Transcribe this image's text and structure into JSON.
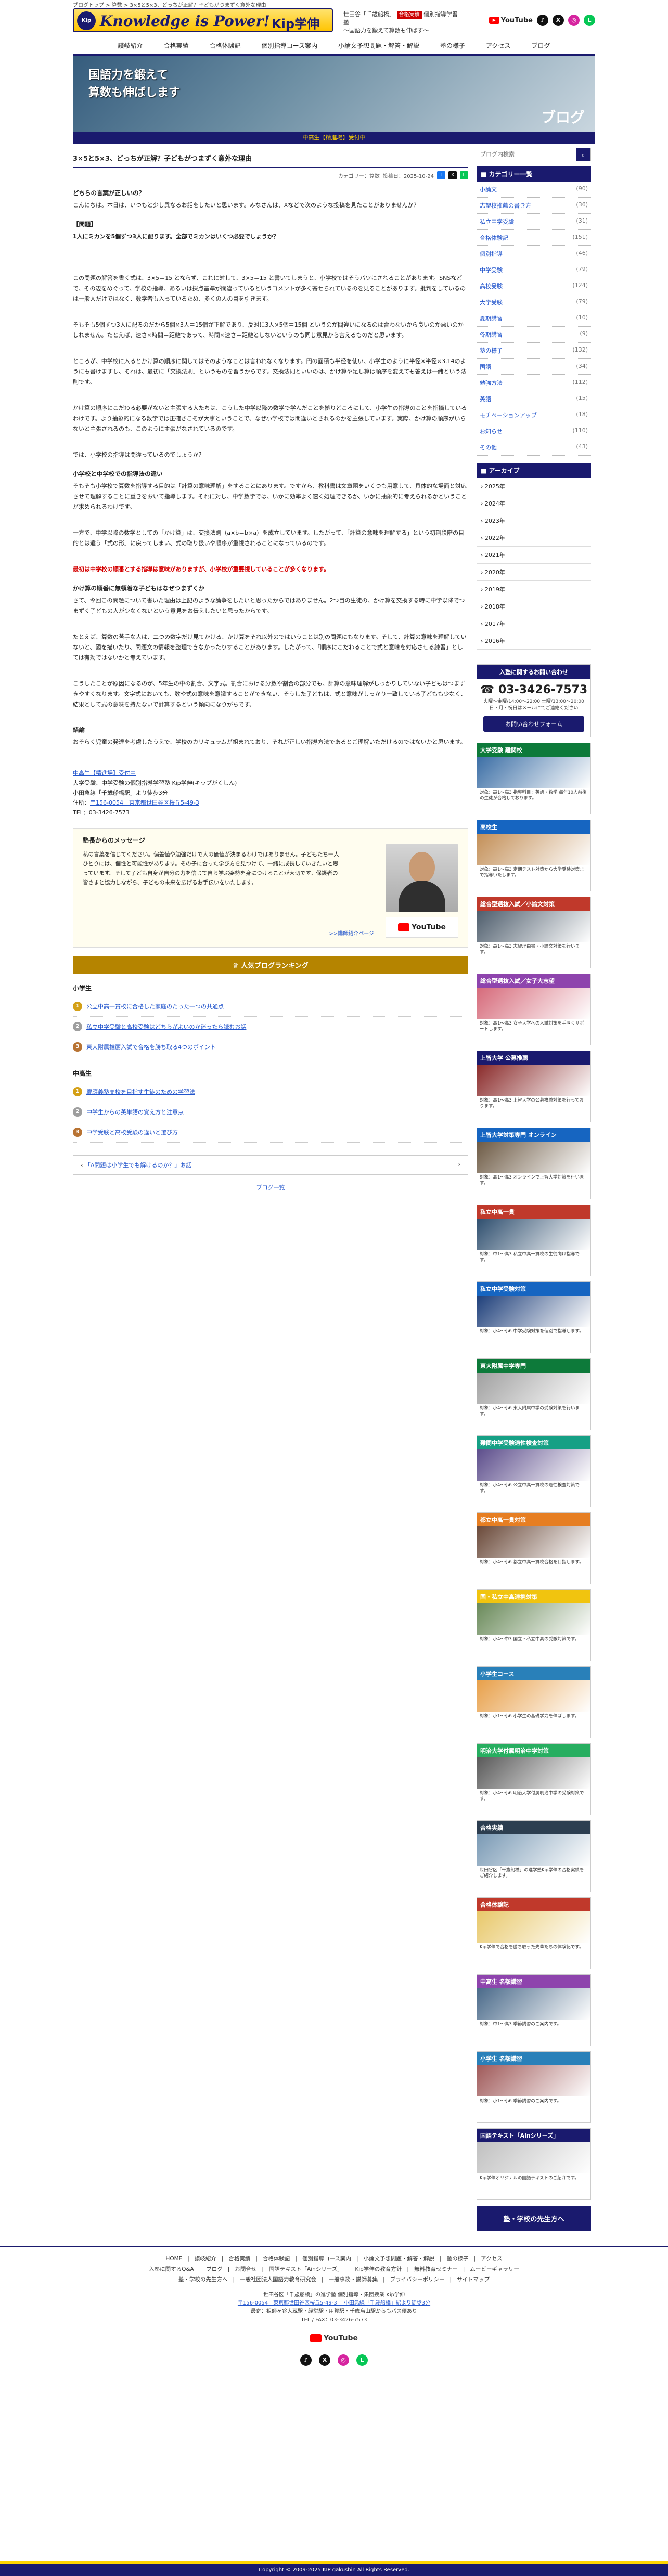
{
  "topline": "ブログトップ > 算数 > 3×5と5×3、どっちが正解？子どもがつまずく意外な理由",
  "header": {
    "logo_badge": "Kip",
    "logo_text": "Knowledge is Power!",
    "logo_name": "Kip学伸",
    "info_pill": "合格実績",
    "info_line1": "世田谷「千歳船橋」",
    "info_line2": "個別指導学習塾",
    "info_line3": "〜国語力を鍛えて算数も伸ばす〜",
    "youtube_label": "YouTube",
    "sns": [
      {
        "name": "tiktok-icon",
        "glyph": "♪",
        "color": "#111111"
      },
      {
        "name": "x-icon",
        "glyph": "X",
        "color": "#111111"
      },
      {
        "name": "instagram-icon",
        "glyph": "◎",
        "color": "#d6249f"
      },
      {
        "name": "line-icon",
        "glyph": "L",
        "color": "#06c755"
      }
    ]
  },
  "nav": [
    "讃岐紹介",
    "合格実績",
    "合格体験記",
    "個別指導コース案内",
    "小論文予想問題・解答・解説",
    "塾の様子",
    "アクセス",
    "ブログ"
  ],
  "banner": {
    "line1": "国語力を鍛えて",
    "line2": "算数も伸ばします",
    "blog_label": "ブログ",
    "bottom_link": "中高生【精進場】受付中"
  },
  "article": {
    "title": "3×5と5×3、どっちが正解？子どもがつまずく意外な理由",
    "category_label": "カテゴリー：算数",
    "date": "投稿日：2025-10-24",
    "share": [
      {
        "name": "facebook-share-icon",
        "glyph": "f",
        "color": "#1877f2"
      },
      {
        "name": "x-share-icon",
        "glyph": "X",
        "color": "#111111"
      },
      {
        "name": "line-share-icon",
        "glyph": "L",
        "color": "#06c755"
      }
    ],
    "p_intro_head": "どちらの言葉が正しいの？",
    "p_intro": "こんにちは。本日は、いつもと少し異なるお話をしたいと思います。みなさんは、Xなどで次のような投稿を見たことがありませんか？",
    "q_label": "【問題】",
    "q_text": "1人にミカンを5個ずつ3人に配ります。全部でミカンはいくつ必要でしょうか？",
    "p1": "この問題の解答を書く式は、3×5＝15 とならず、これに対して、3×5＝15 と書いてしまうと、小学校ではそうバツにされることがあります。SNSなどで、その辺をめぐって、学校の指導、あるいは採点基準が間違っているというコメントが多く寄せられているのを見ることがあります。批判をしているのは一般人だけではなく、数学者も入っているため、多くの人の目を引きます。",
    "p2": "そもそも5個ずつ3人に配るのだから5個×3人＝15個が正解であり、反対に3人×5個＝15個 というのが間違いになるのは合わないから良いのか悪いのかしれません。たとえば、速さ×時間＝距離であって、時間×速さ＝距離としないというのも同じ意見から言えるものだと思います。",
    "p3": "ところが、中学校に入るとかけ算の順序に関してはそのようなことは言われなくなります。円の面積も半径を使い、小学生のように半径×半径×3.14のようにも書けますし、それは、最初に「交換法則」というものを習うからです。交換法則といいのは、かけ算や足し算は順序を変えても答えは一緒という法則です。",
    "p4": "かけ算の順序にこだわる必要がないと主張する人たちは、こうした中学以降の数学で学んだことを拠りどころにして、小学生の指導のことを指摘しているわけです。より抽象的になる数学では正確さこそが大事ということで、なぜ小学校では間違いとされるのかを主張しています。実際、かけ算の順序がいらないと主張されるのも、このように主張がなされているのです。",
    "p5": "では、小学校の指導は間違っているのでしょうか？",
    "h_teach": "小学校と中学校での指導法の違い",
    "p6": "そもそも小学校で算数を指導する目的は「計算の意味理解」をすることにあります。ですから、教科書は文章題をいくつも用意して、具体的な場面と対応させて理解することに重きをおいて指導します。それに対し、中学数学では、いかに効率よく速く処理できるか、いかに抽象的に考えられるかということが求められるわけです。",
    "p7": "一方で、中学以降の数学としての「かけ算」は、交換法則（a×b＝b×a）を成立しています。したがって、「計算の意味を理解する」という初期段階の目的とは違う「式の形」に戻ってしまい、式の取り扱いや順序が重視されることになっているのです。",
    "p8_red": "最初は中学校の順番とする指導は意味がありますが、小学校が重要視していることが多くなります。",
    "h_reason": "かけ算の順番に無頓着な子どもはなぜつまずくか",
    "p9": "さて、今回この問題について書いた理由は上記のような論争をしたいと思ったからではありません。2つ目の生徒の、かけ算を交換する時に中学以降でつまずく子どもの人が少なくないという意見をお伝えしたいと思ったからです。",
    "p10": "たとえば、算数の苦手な人は、二つの数字だけ見てかける、かけ算をそれ以外のではいうことは別の問題にもなります。そして、計算の意味を理解していないと、図を描いたり、問題文の情報を整理できなかったりすることがあります。したがって、「順序にこだわることで式と意味を対応させる練習」としては有効ではないかと考えています。",
    "p11": "こうしたことが原因になるのが、5年生の中の割合、文字式。割合における分数や割合の部分でも、計算の意味理解がしっかりしていない子どもはつまずきやすくなります。文字式においても、数や式の意味を意識することができない、そうした子どもは、式と意味がしっかり一致している子どもも少なく、結果として式の意味を持たないで計算するという傾向になりがちです。",
    "h_conclusion": "結論",
    "p12": "おそらく児童の発達を考慮したうえで、学校のカリキュラムが組まれており、それが正しい指導方法であるとご理解いただけるのではないかと思います。",
    "school_link": "中高生【精進場】受付中",
    "school_line1": "大学受験、中学受験の個別指導学習塾 Kip学伸(キップがくしん)",
    "school_line2": "小田急線「千歳船橋駅」より徒歩3分",
    "school_addr_label": "住所：",
    "school_addr": "〒156-0054　東京都世田谷区桜丘5-49-3",
    "school_tel": "TEL：03-3426-7573"
  },
  "message": {
    "title": "塾長からのメッセージ",
    "text": "私の言葉を信じてください。偏差値や勉強だけで人の価値が決まるわけではありません。子どもたち一人ひとりには、個性と可能性があります。その子に合った学び方を見つけて、一緒に成長していきたいと思っています。そして子ども自身が自分の力を信じて自ら学ぶ姿勢を身につけることが大切です。保護者の皆さまと協力しながら、子どもの未来を広げるお手伝いをいたします。",
    "more": ">>講師紹介ページ",
    "yt_label": "YouTube"
  },
  "popular": {
    "bar": "人気ブログランキング",
    "primary_head": "小学生",
    "primary": [
      "公立中高一貫校に合格した家庭のたった一つの共通点",
      "私立中学受験と高校受験はどちらがよいのか迷ったら読むお話",
      "東大附属推薦入試で合格を勝ち取る4つのポイント"
    ],
    "junior_head": "中高生",
    "junior": [
      "慶應義塾高校を目指す生徒のための学習法",
      "中学生からの英単語の覚え方と注意点",
      "中学受験と高校受験の違いと選び方"
    ]
  },
  "pager": {
    "prev": "「A問題は小学生でも解けるのか？」お話",
    "next": "",
    "blog_list": "ブログ一覧"
  },
  "side": {
    "search_placeholder": "ブログ内検索",
    "cat_head": "カテゴリー一覧",
    "categories": [
      {
        "label": "小論文",
        "count": "(90)"
      },
      {
        "label": "志望校推薦の書き方",
        "count": "(36)"
      },
      {
        "label": "私立中学受験",
        "count": "(31)"
      },
      {
        "label": "合格体験記",
        "count": "(151)"
      },
      {
        "label": "個別指導",
        "count": "(46)"
      },
      {
        "label": "中学受験",
        "count": "(79)"
      },
      {
        "label": "高校受験",
        "count": "(124)"
      },
      {
        "label": "大学受験",
        "count": "(79)"
      },
      {
        "label": "夏期講習",
        "count": "(10)"
      },
      {
        "label": "冬期講習",
        "count": "(9)"
      },
      {
        "label": "塾の様子",
        "count": "(132)"
      },
      {
        "label": "国語",
        "count": "(34)"
      },
      {
        "label": "勉強方法",
        "count": "(112)"
      },
      {
        "label": "英語",
        "count": "(15)"
      },
      {
        "label": "モチベーションアップ",
        "count": "(18)"
      },
      {
        "label": "お知らせ",
        "count": "(110)"
      },
      {
        "label": "その他",
        "count": "(43)"
      }
    ],
    "arc_head": "アーカイブ",
    "archives": [
      "2025年",
      "2024年",
      "2023年",
      "2022年",
      "2021年",
      "2020年",
      "2019年",
      "2018年",
      "2017年",
      "2016年"
    ],
    "contact_head": "入塾に関するお問い合わせ",
    "tel": "03-3426-7573",
    "hours": "火曜〜金曜/14:00〜22:00 土曜/13:00〜20:00 日・月・祝日はメールにてご連絡ください",
    "mail_btn": "お問い合わせフォーム",
    "promos": [
      {
        "title": "大学受験 難関校",
        "color": "#0d7a3a",
        "img": "#3b6ea5",
        "text": "対象：高1〜高3 指導科目：英語・数学 毎年10人前後の生徒が合格しております。"
      },
      {
        "title": "高校生",
        "color": "#1665c1",
        "img": "#c38f57",
        "text": "対象：高1〜高3 定期テスト対策から大学受験対策まで指導いたします。"
      },
      {
        "title": "総合型選抜入試／小論文対策",
        "color": "#c0392b",
        "img": "#4e5d6c",
        "text": "対象：高1〜高3 志望理由書・小論文対策を行います。"
      },
      {
        "title": "総合型選抜入試／女子大志望",
        "color": "#8e44ad",
        "img": "#d66a7a",
        "text": "対象：高1〜高3 女子大学への入試対策を手厚くサポートします。"
      },
      {
        "title": "上智大学 公募推薦",
        "color": "#1a1a6e",
        "img": "#8a2a2a",
        "text": "対象：高1〜高3 上智大学の公募推薦対策を行っております。"
      },
      {
        "title": "上智大学対策専門 オンライン",
        "color": "#1665c1",
        "img": "#6d5a44",
        "text": "対象：高1〜高3 オンラインで上智大学対策を行います。"
      },
      {
        "title": "私立中高一貫",
        "color": "#c0392b",
        "img": "#2f4f6f",
        "text": "対象：中1〜高3 私立中高一貫校の生徒向け指導です。"
      },
      {
        "title": "私立中学受験対策",
        "color": "#1665c1",
        "img": "#1e3f7a",
        "text": "対象：小4〜小6 中学受験対策を個別で指導します。"
      },
      {
        "title": "東大附属中学専門",
        "color": "#0d7a3a",
        "img": "#a0a0a0",
        "text": "対象：小4〜小6 東大附属中学の受験対策を行います。"
      },
      {
        "title": "難関中学受験適性検査対策",
        "color": "#16a085",
        "img": "#5d4e8c",
        "text": "対象：小4〜小6 公立中高一貫校の適性検査対策です。"
      },
      {
        "title": "都立中高一貫対策",
        "color": "#e67e22",
        "img": "#6b4a3a",
        "text": "対象：小4〜小6 都立中高一貫校合格を目指します。"
      },
      {
        "title": "国・私立中高連携対策",
        "color": "#f1c40f",
        "img": "#6a8a5a",
        "text": "対象：小4〜中3 国立・私立中高の受験対策です。"
      },
      {
        "title": "小学生コース",
        "color": "#2980b9",
        "img": "#e8a04a",
        "text": "対象：小1〜小6 小学生の基礎学力を伸ばします。"
      },
      {
        "title": "明治大学付属明治中学対策",
        "color": "#27ae60",
        "img": "#5a5a5a",
        "text": "対象：小4〜小6 明治大学付属明治中学の受験対策です。"
      },
      {
        "title": "合格実績",
        "color": "#2c3e50",
        "img": "#7a9ab5",
        "text": "世田谷区「千歳船橋」の進学塾Kip学伸の合格実績をご紹介します。"
      },
      {
        "title": "合格体験記",
        "color": "#c0392b",
        "img": "#e8c86a",
        "text": "Kip学伸で合格を勝ち取った先輩たちの体験記です。"
      },
      {
        "title": "中高生 名額講習",
        "color": "#8e44ad",
        "img": "#4a6a8a",
        "text": "対象：中1〜高3 季節講習のご案内です。"
      },
      {
        "title": "小学生 名額講習",
        "color": "#2980b9",
        "img": "#a05a5a",
        "text": "対象：小1〜小6 季節講習のご案内です。"
      },
      {
        "title": "国語テキスト「Ainシリーズ」",
        "color": "#1a1a6e",
        "img": "#c0c0c0",
        "text": "Kip学伸オリジナルの国語テキストのご紹介です。"
      }
    ],
    "cta": "塾・学校の先生方へ"
  },
  "footer": {
    "links1": [
      "HOME",
      "讃岐紹介",
      "合格実績",
      "合格体験記",
      "個別指導コース案内",
      "小論文予想問題・解答・解説",
      "塾の様子",
      "アクセス"
    ],
    "links2": [
      "入塾に関するQ&A",
      "ブログ",
      "お問合せ",
      "国語テキスト「Ainシリーズ」",
      "Kip学伸の教育方針",
      "無料教育セミナー",
      "ムービーギャラリー"
    ],
    "links3": [
      "塾・学校の先生方へ",
      "一般社団法人国語力教育研究会",
      "一般事務・講師募集",
      "プライバシーポリシー",
      "サイトマップ"
    ],
    "addr1": "世田谷区「千歳船橋」の進学塾 個別指導・集団授業 Kip学伸",
    "addr2": "〒156-0054　東京都世田谷区桜丘5-49-3 　小田急線「千歳船橋」駅より徒歩3分",
    "addr3": "最寄：祖師ヶ谷大蔵駅・経堂駅・用賀駅・千歳烏山駅からもバス便あり",
    "tel": "TEL / FAX：03-3426-7573",
    "yt": "YouTube",
    "copyright": "Copyright © 2009-2025 KIP gakushin All Rights Reserved."
  }
}
